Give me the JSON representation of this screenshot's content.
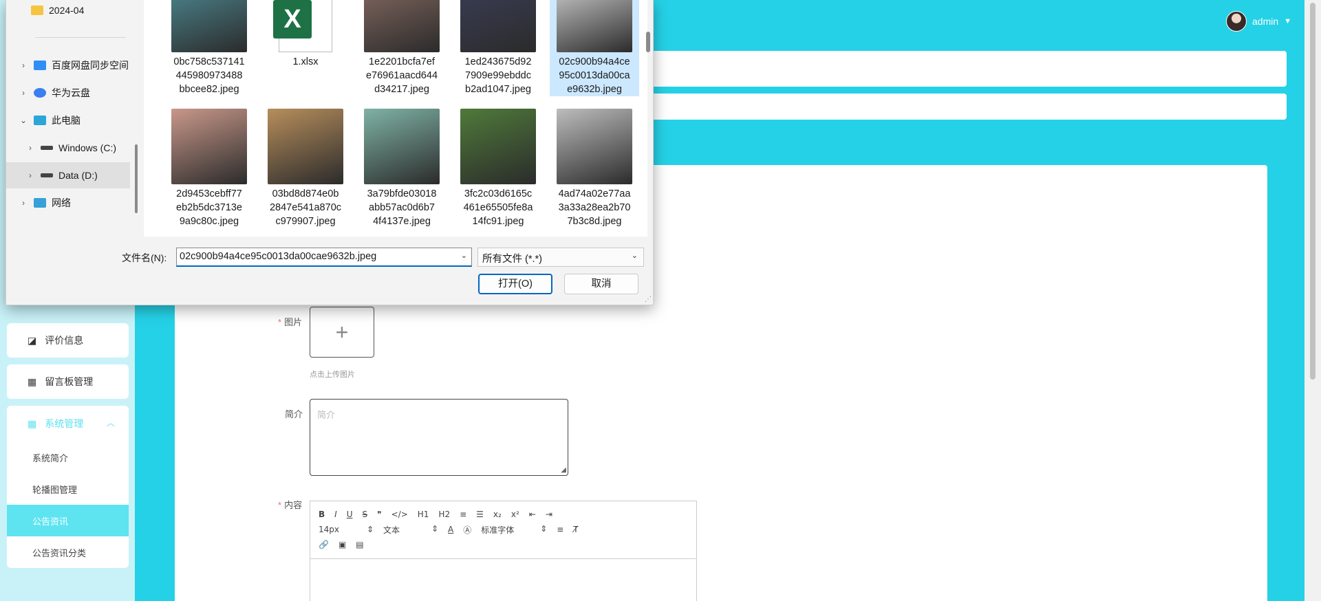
{
  "app": {
    "user": "admin",
    "sidebar": {
      "items": [
        {
          "label": "评价信息",
          "icon": "chart-icon"
        },
        {
          "label": "留言板管理",
          "icon": "grid-icon"
        }
      ],
      "group": {
        "label": "系统管理",
        "icon": "grid-icon",
        "children": [
          {
            "label": "系统简介",
            "active": false
          },
          {
            "label": "轮播图管理",
            "active": false
          },
          {
            "label": "公告资讯",
            "active": true
          },
          {
            "label": "公告资讯分类",
            "active": false
          }
        ]
      }
    },
    "form": {
      "image_label": "图片",
      "upload_plus": "+",
      "upload_hint": "点击上传图片",
      "intro_label": "简介",
      "intro_placeholder": "简介",
      "content_label": "内容",
      "editor": {
        "row1": [
          "B",
          "I",
          "U",
          "S",
          "❞",
          "</>",
          "H1",
          "H2",
          "≡",
          "☰",
          "x₂",
          "x²",
          "⇤",
          "⇥"
        ],
        "font_size": "14px",
        "text_style": "文本",
        "font_family": "标准字体",
        "row3": [
          "🔗",
          "▣",
          "▤"
        ]
      }
    }
  },
  "dialog": {
    "tree": [
      {
        "label": "2024-04",
        "icon": "folder-icon",
        "arrow": ""
      },
      {
        "label": "百度网盘同步空间",
        "icon": "baidu-netdisk-icon",
        "arrow": "›"
      },
      {
        "label": "华为云盘",
        "icon": "huawei-cloud-icon",
        "arrow": "›"
      },
      {
        "label": "此电脑",
        "icon": "computer-icon",
        "arrow": "⌄"
      },
      {
        "label": "Windows (C:)",
        "icon": "drive-icon",
        "arrow": "›"
      },
      {
        "label": "Data (D:)",
        "icon": "drive-icon",
        "arrow": "›"
      },
      {
        "label": "网络",
        "icon": "network-icon",
        "arrow": "›"
      }
    ],
    "files": [
      {
        "name": "0bc758c537141445980973488bbcee82.jpeg",
        "lines": [
          "0bc758c537141",
          "445980973488",
          "bbcee82.jpeg"
        ],
        "color": "#4f8f99"
      },
      {
        "name": "1.xlsx",
        "lines": [
          "1.xlsx"
        ],
        "color": "#1e7145"
      },
      {
        "name": "1e2201bcfa7efe76961aacd644d34217.jpeg",
        "lines": [
          "1e2201bcfa7ef",
          "e76961aacd644",
          "d34217.jpeg"
        ],
        "color": "#8a6d64"
      },
      {
        "name": "1ed243675d927909e99ebddcb2ad1047.jpeg",
        "lines": [
          "1ed243675d92",
          "7909e99ebddc",
          "b2ad1047.jpeg"
        ],
        "color": "#3b3f5a"
      },
      {
        "name": "02c900b94a4ce95c0013da00cae9632b.jpeg",
        "lines": [
          "02c900b94a4ce",
          "95c0013da00ca",
          "e9632b.jpeg"
        ],
        "color": "#d9d9d9"
      },
      {
        "name": "2d9453cebff77eb2b5dc3713e9a9c80c.jpeg",
        "lines": [
          "2d9453cebff77",
          "eb2b5dc3713e",
          "9a9c80c.jpeg"
        ],
        "color": "#c9988a"
      },
      {
        "name": "03bd8d874e0b2847e541a870cc979907.jpeg",
        "lines": [
          "03bd8d874e0b",
          "2847e541a870c",
          "c979907.jpeg"
        ],
        "color": "#b78e5c"
      },
      {
        "name": "3a79bfde03018abb57ac0d6b74f4137e.jpeg",
        "lines": [
          "3a79bfde03018",
          "abb57ac0d6b7",
          "4f4137e.jpeg"
        ],
        "color": "#7fb3a5"
      },
      {
        "name": "3fc2c03d6165c461e65505fe8a14fc91.jpeg",
        "lines": [
          "3fc2c03d6165c",
          "461e65505fe8a",
          "14fc91.jpeg"
        ],
        "color": "#4f7a3a"
      },
      {
        "name": "4ad74a02e77aa3a33a28ea2b707b3c8d.jpeg",
        "lines": [
          "4ad74a02e77aa",
          "3a33a28ea2b70",
          "7b3c8d.jpeg"
        ],
        "color": "#bdbdbd"
      }
    ],
    "selected_file": "02c900b94a4ce95c0013da00cae9632b.jpeg",
    "filename_label": "文件名(N):",
    "filename_value": "02c900b94a4ce95c0013da00cae9632b.jpeg",
    "filetype_value": "所有文件 (*.*)",
    "open_button": "打开(O)",
    "cancel_button": "取消"
  }
}
